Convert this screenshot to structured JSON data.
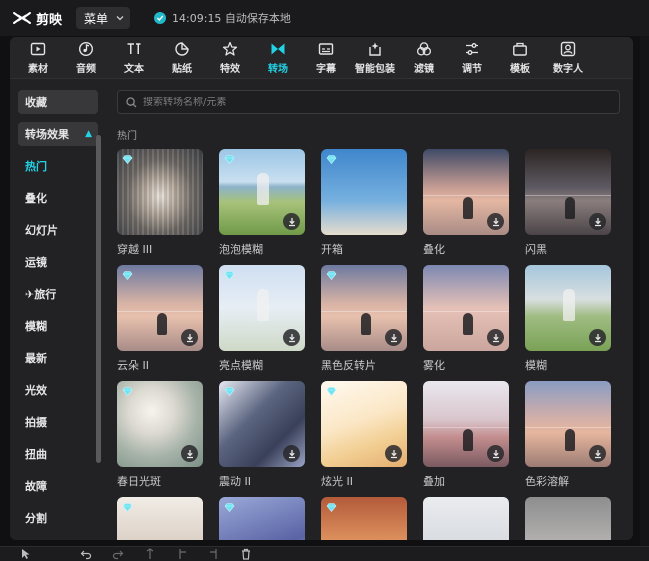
{
  "app": {
    "name": "剪映",
    "menu_label": "菜单",
    "save_status": "14:09:15 自动保存本地"
  },
  "toolbar": {
    "items": [
      {
        "label": "素材",
        "icon": "media-icon"
      },
      {
        "label": "音频",
        "icon": "audio-icon"
      },
      {
        "label": "文本",
        "icon": "text-icon"
      },
      {
        "label": "贴纸",
        "icon": "sticker-icon"
      },
      {
        "label": "特效",
        "icon": "effects-icon"
      },
      {
        "label": "转场",
        "icon": "transition-icon",
        "active": true
      },
      {
        "label": "字幕",
        "icon": "subtitle-icon"
      },
      {
        "label": "智能包装",
        "icon": "smart-pack-icon"
      },
      {
        "label": "滤镜",
        "icon": "filter-icon"
      },
      {
        "label": "调节",
        "icon": "adjust-icon"
      },
      {
        "label": "模板",
        "icon": "template-icon"
      },
      {
        "label": "数字人",
        "icon": "avatar-icon"
      }
    ],
    "accent": "#22d3e6"
  },
  "sidebar": {
    "items": [
      {
        "label": "收藏",
        "style": "box"
      },
      {
        "label": "转场效果",
        "style": "box-cyan",
        "expanded": true
      },
      {
        "label": "热门",
        "style": "cyan"
      },
      {
        "label": "叠化"
      },
      {
        "label": "幻灯片"
      },
      {
        "label": "运镜"
      },
      {
        "label": "✈旅行"
      },
      {
        "label": "模糊"
      },
      {
        "label": "最新"
      },
      {
        "label": "光效"
      },
      {
        "label": "拍摄"
      },
      {
        "label": "扭曲"
      },
      {
        "label": "故障"
      },
      {
        "label": "分割"
      }
    ]
  },
  "search": {
    "placeholder": "搜索转场名称/元素",
    "value": ""
  },
  "section": {
    "title": "热门"
  },
  "cards": [
    {
      "label": "穿越 III",
      "thumb": "t-tunnel",
      "vip": true,
      "download": false
    },
    {
      "label": "泡泡模糊",
      "thumb": "t-beach",
      "vip": true,
      "download": true
    },
    {
      "label": "开箱",
      "thumb": "t-tower",
      "vip": true,
      "download": false
    },
    {
      "label": "叠化",
      "thumb": "t-sunset",
      "vip": false,
      "download": true
    },
    {
      "label": "闪黑",
      "thumb": "t-dark",
      "vip": false,
      "download": true
    },
    {
      "label": "云朵 II",
      "thumb": "t-sea",
      "vip": true,
      "download": true
    },
    {
      "label": "亮点模糊",
      "thumb": "t-pale",
      "vip": true,
      "download": true
    },
    {
      "label": "黑色反转片",
      "thumb": "t-sea",
      "vip": true,
      "download": true
    },
    {
      "label": "雾化",
      "thumb": "t-pinkfog",
      "vip": false,
      "download": true
    },
    {
      "label": "模糊",
      "thumb": "t-field",
      "vip": false,
      "download": true
    },
    {
      "label": "春日光斑",
      "thumb": "t-spring",
      "vip": true,
      "download": true
    },
    {
      "label": "震动 II",
      "thumb": "t-shake",
      "vip": true,
      "download": true
    },
    {
      "label": "炫光 II",
      "thumb": "t-glare",
      "vip": true,
      "download": true
    },
    {
      "label": "叠加",
      "thumb": "t-dusk",
      "vip": false,
      "download": true
    },
    {
      "label": "色彩溶解",
      "thumb": "t-color",
      "vip": false,
      "download": true
    },
    {
      "label": "",
      "thumb": "t-r5a",
      "vip": true,
      "download": false
    },
    {
      "label": "",
      "thumb": "t-r5b",
      "vip": true,
      "download": false
    },
    {
      "label": "",
      "thumb": "t-r5c",
      "vip": true,
      "download": false
    },
    {
      "label": "",
      "thumb": "t-r5d",
      "vip": false,
      "download": false
    },
    {
      "label": "",
      "thumb": "t-r5e",
      "vip": false,
      "download": false
    }
  ],
  "bottombar": {
    "icons": [
      "select-icon",
      "undo-icon",
      "redo-icon",
      "split-icon",
      "split-left-icon",
      "split-right-icon",
      "delete-icon"
    ]
  }
}
